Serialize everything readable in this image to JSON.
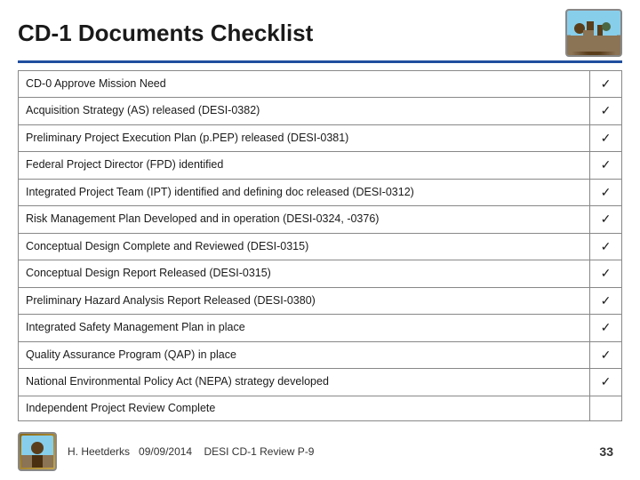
{
  "header": {
    "title": "CD-1 Documents Checklist"
  },
  "checklist": {
    "items": [
      {
        "label": "CD-0 Approve Mission Need",
        "checked": true
      },
      {
        "label": "Acquisition Strategy (AS) released   (DESI-0382)",
        "checked": true
      },
      {
        "label": "Preliminary Project Execution Plan (p.PEP) released  (DESI-0381)",
        "checked": true
      },
      {
        "label": "Federal Project Director (FPD) identified",
        "checked": true
      },
      {
        "label": "Integrated Project Team (IPT) identified and defining doc released (DESI-0312)",
        "checked": true
      },
      {
        "label": "Risk Management Plan Developed and in operation  (DESI-0324, -0376)",
        "checked": true
      },
      {
        "label": "Conceptual Design Complete and Reviewed    (DESI-0315)",
        "checked": true
      },
      {
        "label": "Conceptual Design Report Released           (DESI-0315)",
        "checked": true
      },
      {
        "label": "Preliminary Hazard Analysis Report Released   (DESI-0380)",
        "checked": true
      },
      {
        "label": "Integrated Safety Management Plan in place",
        "checked": true
      },
      {
        "label": "Quality Assurance Program (QAP) in place",
        "checked": true
      },
      {
        "label": "National Environmental Policy Act (NEPA) strategy developed",
        "checked": true
      },
      {
        "label": "Independent Project Review Complete",
        "checked": false
      }
    ],
    "check_symbol": "✓"
  },
  "footer": {
    "author": "H. Heetderks",
    "date": "09/09/2014",
    "presentation": "DESI CD-1 Review  P-9",
    "page_number": "33"
  }
}
